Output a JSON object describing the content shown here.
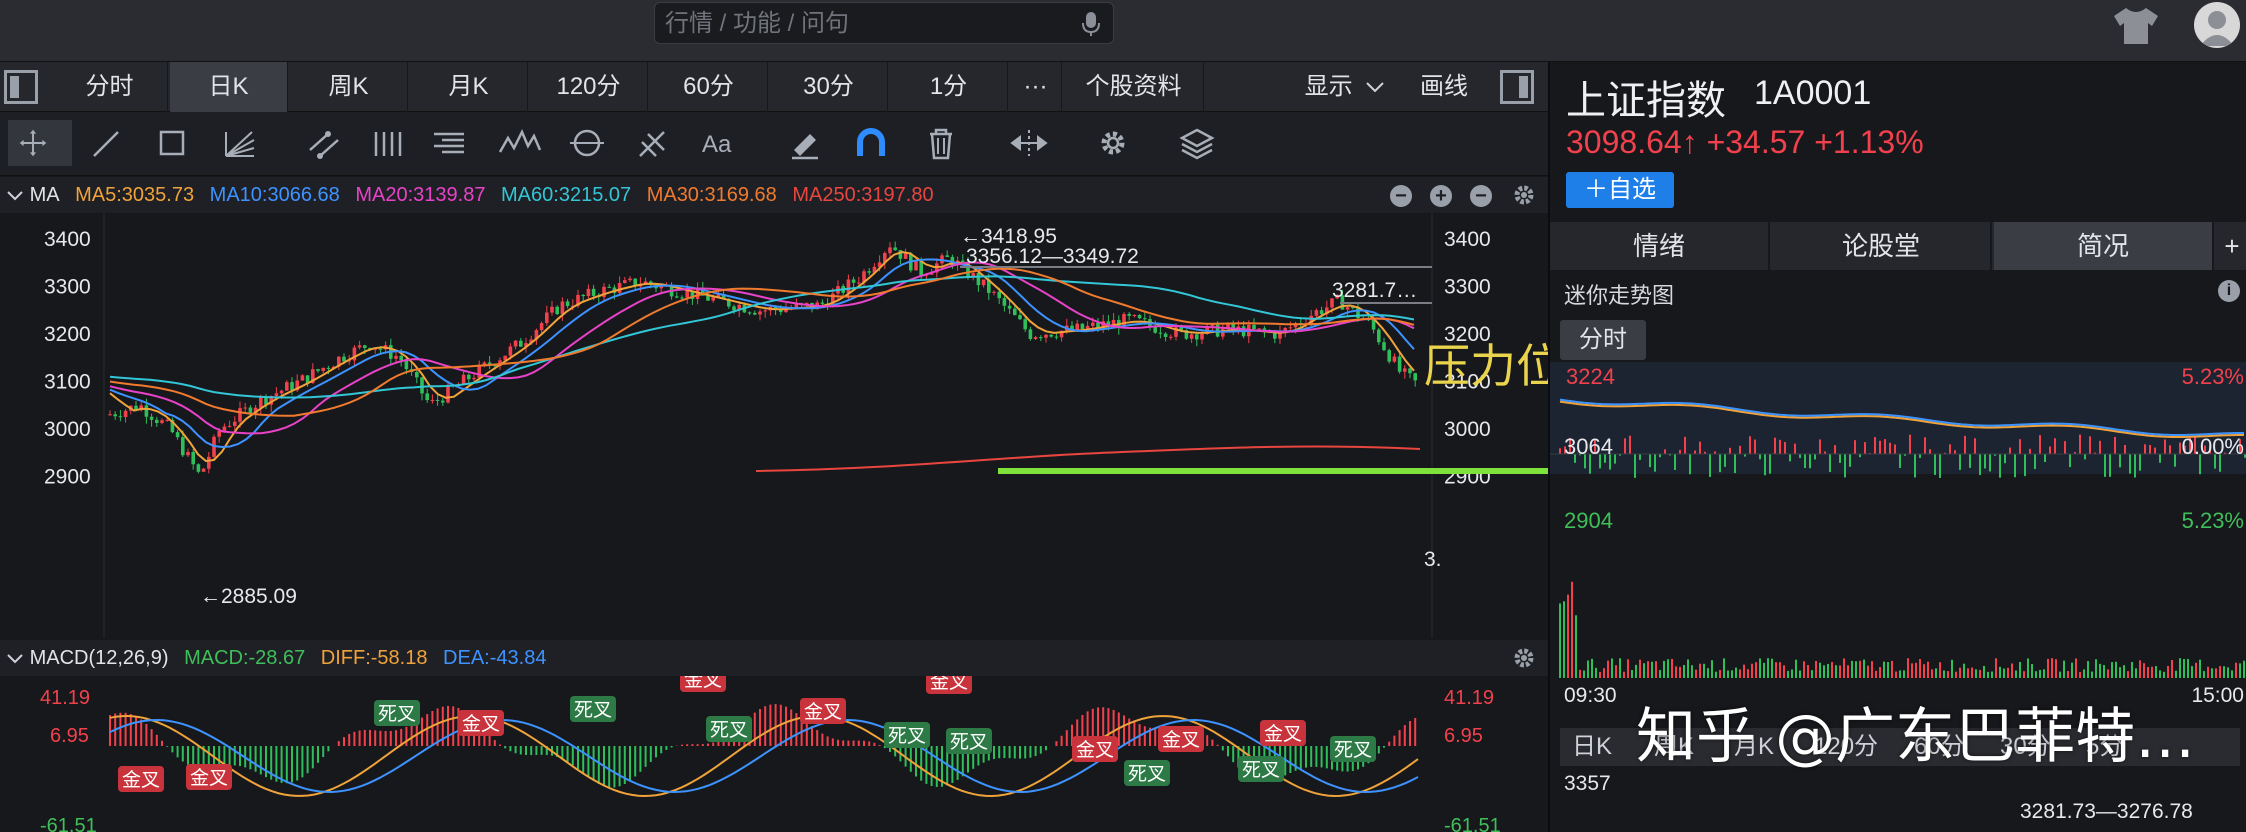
{
  "search": {
    "placeholder": "行情 / 功能 / 问句"
  },
  "period_tabs": [
    "分时",
    "日K",
    "周K",
    "月K",
    "120分",
    "60分",
    "30分",
    "1分",
    "···",
    "个股资料"
  ],
  "period_active": "日K",
  "display_menu": {
    "label": "显示",
    "draw_label": "画线"
  },
  "ma": {
    "label": "MA",
    "items": [
      {
        "text": "MA5:3035.73",
        "color": "#f0a33a"
      },
      {
        "text": "MA10:3066.68",
        "color": "#3d93ff"
      },
      {
        "text": "MA20:3139.87",
        "color": "#e843c8"
      },
      {
        "text": "MA60:3215.07",
        "color": "#32c6d6"
      },
      {
        "text": "MA30:3169.68",
        "color": "#f07a2e"
      },
      {
        "text": "MA250:3197.80",
        "color": "#e8463f"
      }
    ]
  },
  "macd": {
    "label": "MACD(12,26,9)",
    "items": [
      {
        "text": "MACD:-28.67",
        "color": "#3fbf5a"
      },
      {
        "text": "DIFF:-58.18",
        "color": "#f0a33a"
      },
      {
        "text": "DEA:-43.84",
        "color": "#3d93ff"
      }
    ],
    "axis_labels": [
      "41.19",
      "6.95",
      "-61.51"
    ],
    "golden_cross": "金叉",
    "death_cross": "死叉"
  },
  "kchart": {
    "y_ticks": [
      "3400",
      "3300",
      "3200",
      "3100",
      "3000",
      "2900"
    ],
    "high_label": "←3418.95",
    "range_label": "3356.12—3349.72",
    "right_label": "3281.7…",
    "low_label": "←2885.09",
    "current_tail": "3."
  },
  "annotation": {
    "text": "压力位",
    "color": "#e9d44c",
    "line_color": "#7fe23a"
  },
  "index": {
    "name": "上证指数",
    "code": "1A0001",
    "quote": "3098.64↑ +34.57 +1.13%",
    "watch_label": "＋自选"
  },
  "right_tabs": [
    "情绪",
    "论股堂",
    "简况"
  ],
  "right_tab_active": "简况",
  "right_tab_plus": "+",
  "mini": {
    "title": "迷你走势图",
    "tab": "分时",
    "top_price": "3224",
    "top_pct": "5.23%",
    "mid_price": "3064",
    "mid_pct": "0.00%",
    "bottom_price": "2904",
    "bottom_pct": "5.23%",
    "time_start": "09:30",
    "time_end": "15:00",
    "bottom_tabs": [
      "日K",
      "周K",
      "月K",
      "120分",
      "60分",
      "30分",
      "5分"
    ],
    "kline_price": "3357",
    "kline_range": "3281.73—3276.78"
  },
  "watermark": "知乎 @广东巴菲特…"
}
